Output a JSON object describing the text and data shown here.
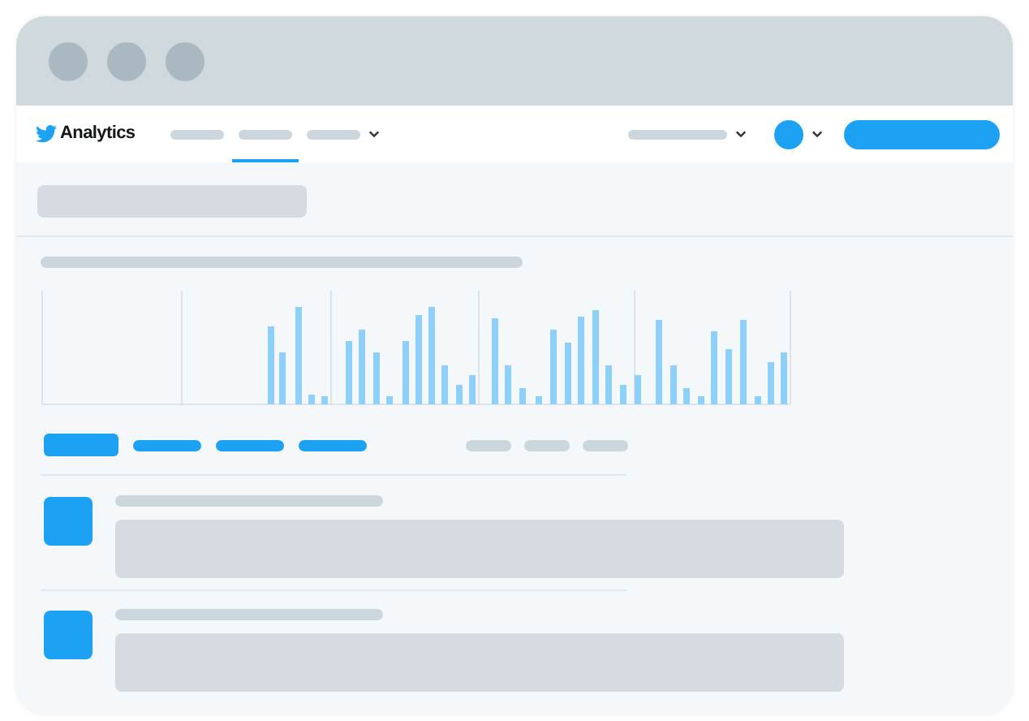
{
  "app": {
    "name": "Analytics"
  },
  "nav": [
    {
      "selected": false,
      "dropdown": false
    },
    {
      "selected": true,
      "dropdown": false
    },
    {
      "selected": false,
      "dropdown": true
    }
  ],
  "tabs": [
    {
      "selected": true
    },
    {
      "selected": false
    },
    {
      "selected": false
    },
    {
      "selected": false
    }
  ]
}
